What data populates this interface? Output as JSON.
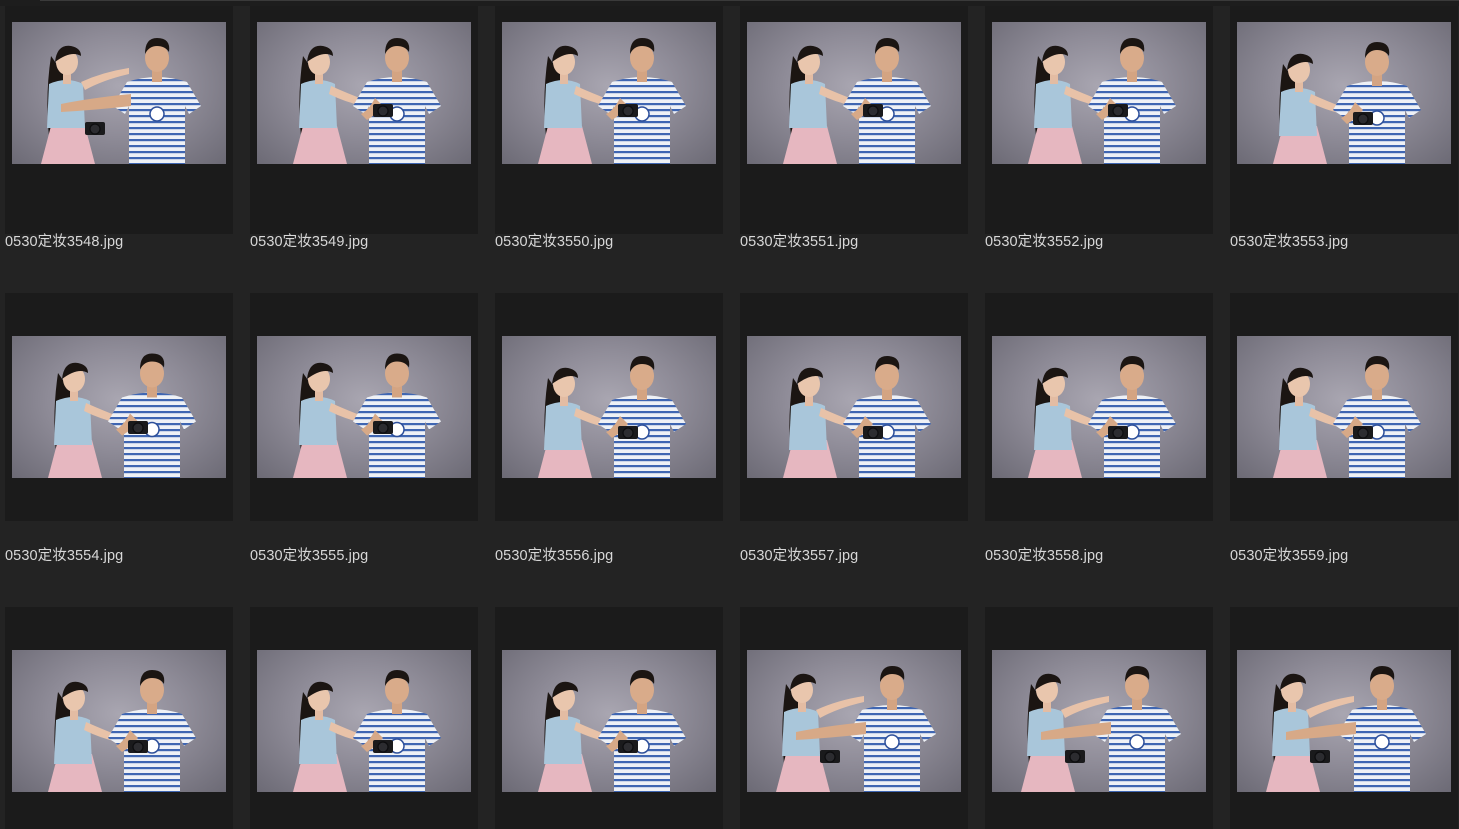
{
  "browser": {
    "files": [
      {
        "name": "0530定妆3548.jpg",
        "pose": "point"
      },
      {
        "name": "0530定妆3549.jpg",
        "pose": "surprise"
      },
      {
        "name": "0530定妆3550.jpg",
        "pose": "touch"
      },
      {
        "name": "0530定妆3551.jpg",
        "pose": "touch"
      },
      {
        "name": "0530定妆3552.jpg",
        "pose": "touch"
      },
      {
        "name": "0530定妆3553.jpg",
        "pose": "lean"
      },
      {
        "name": "0530定妆3554.jpg",
        "pose": "look"
      },
      {
        "name": "0530定妆3555.jpg",
        "pose": "look"
      },
      {
        "name": "0530定妆3556.jpg",
        "pose": "lean"
      },
      {
        "name": "0530定妆3557.jpg",
        "pose": "lean"
      },
      {
        "name": "0530定妆3558.jpg",
        "pose": "lean"
      },
      {
        "name": "0530定妆3559.jpg",
        "pose": "lean"
      },
      {
        "name": "",
        "pose": "lean"
      },
      {
        "name": "",
        "pose": "lean"
      },
      {
        "name": "",
        "pose": "lean"
      },
      {
        "name": "",
        "pose": "point"
      },
      {
        "name": "",
        "pose": "point"
      },
      {
        "name": "",
        "pose": "point"
      }
    ]
  },
  "colors": {
    "background": "#232323",
    "frame": "#1b1b1b",
    "text": "#d8d8d8",
    "top_shirt": "#a9c6da",
    "skirt": "#e6b7c0",
    "striped_shirt": "#eef1f6",
    "stripe": "#3f66b2",
    "hair": "#1b1512"
  }
}
